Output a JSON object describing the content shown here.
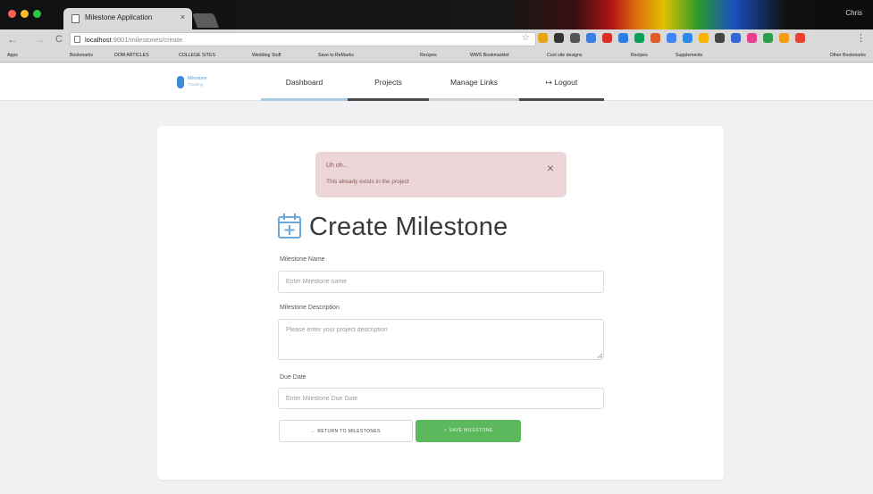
{
  "browser": {
    "tab_title": "Milestone Application",
    "tab_close": "×",
    "user_name": "Chris",
    "nav_back": "←",
    "nav_forward": "→",
    "nav_reload": "C",
    "url_host": "localhost",
    "url_path": ":9001/milestones/create",
    "star": "☆",
    "menu": "⋮",
    "extension_colors": [
      "#e8a317",
      "#333333",
      "#555555",
      "#3b7de0",
      "#d93025",
      "#2a7de1",
      "#0f9d58",
      "#e05a2b",
      "#4285f4",
      "#2b8ae8",
      "#f4b400",
      "#444444",
      "#3367d6",
      "#e83e8c",
      "#2d9d4a",
      "#f39c12",
      "#ea4335"
    ]
  },
  "bookmarks": {
    "items": [
      "Apps",
      "Bookmarks",
      "DOM ARTICLES",
      "COLLEGE SITES",
      "Wedding Stuff",
      "Save to ReMarks",
      "Recipes",
      "WWS Bookmarklet",
      "Cool site designs",
      "Recipes",
      "Supplements"
    ],
    "other": "Other Bookmarks"
  },
  "site": {
    "brand_name": "Milestone",
    "brand_tagline": "Tracking",
    "brand_color": "#3d8bd6",
    "nav": {
      "dashboard": "Dashboard",
      "projects": "Projects",
      "manage_links": "Manage Links",
      "logout": "Logout",
      "logout_icon": "↦"
    }
  },
  "alert": {
    "title": "Uh oh...",
    "message": "This already exists in the project",
    "close": "×",
    "background": "#ecd5d6"
  },
  "form": {
    "title": "Create Milestone",
    "icon": "calendar-plus-icon",
    "accent_color": "#6aa9dc",
    "name_label": "Milestone Name",
    "name_placeholder": "Enter Milestone name",
    "description_label": "Milestone Description",
    "description_placeholder": "Please enter your project description",
    "due_label": "Due Date",
    "due_placeholder": "Enter Milestone Due Date",
    "return_button": "← RETURN TO MILESTONES",
    "save_button": "✓ SAVE MILESTONE",
    "save_color": "#5cb85c"
  }
}
